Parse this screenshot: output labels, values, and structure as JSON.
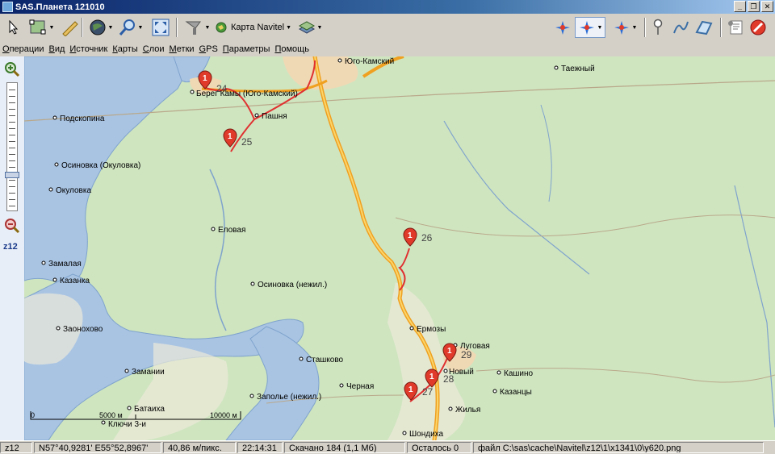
{
  "window": {
    "title": "SAS.Планета 121010",
    "buttons": [
      "_",
      "❐",
      "✕"
    ]
  },
  "toolbar": {
    "map_type": "Карта Navitel"
  },
  "menu": [
    "Операции",
    "Вид",
    "Источник",
    "Карты",
    "Слои",
    "Метки",
    "GPS",
    "Параметры",
    "Помощь"
  ],
  "zoom": {
    "label": "z12"
  },
  "map": {
    "places": [
      "Юго-Камский",
      "Таежный",
      "Берег Камы (Юго-Камский)",
      "Пашня",
      "Подскопина",
      "Осиновка (Окуловка)",
      "Окуловка",
      "Еловая",
      "Замалая",
      "Казанка",
      "Осиновка (нежил.)",
      "Заонохово",
      "Ермозы",
      "Луговая",
      "Новый",
      "Кашино",
      "Казанцы",
      "Сташково",
      "Замании",
      "Черная",
      "Заполье (нежил.)",
      "Батаиха",
      "Ключи 3-и",
      "Жилья",
      "Шондиха"
    ],
    "markers": [
      "24",
      "25",
      "26",
      "27",
      "28",
      "29"
    ],
    "marker_symbol": "1",
    "scale": {
      "zero": "0",
      "left_value": "5000 м",
      "right_value": "10000 м"
    }
  },
  "status": {
    "zoom": "z12",
    "coords": "N57°40,9281' E55°52,8967'",
    "resolution": "40,86 м/пикс.",
    "time": "22:14:31",
    "downloaded": "Скачано 184 (1,1 Мб)",
    "remaining": "Осталось 0",
    "file": "файл C:\\sas\\cache\\Navitel\\z12\\1\\x1341\\0\\y620.png"
  },
  "colors": {
    "road": "#f0a020",
    "route": "#e03030",
    "water": "#a9c4e3",
    "forest": "#cfe5c0",
    "marker": "#e03a2a"
  }
}
